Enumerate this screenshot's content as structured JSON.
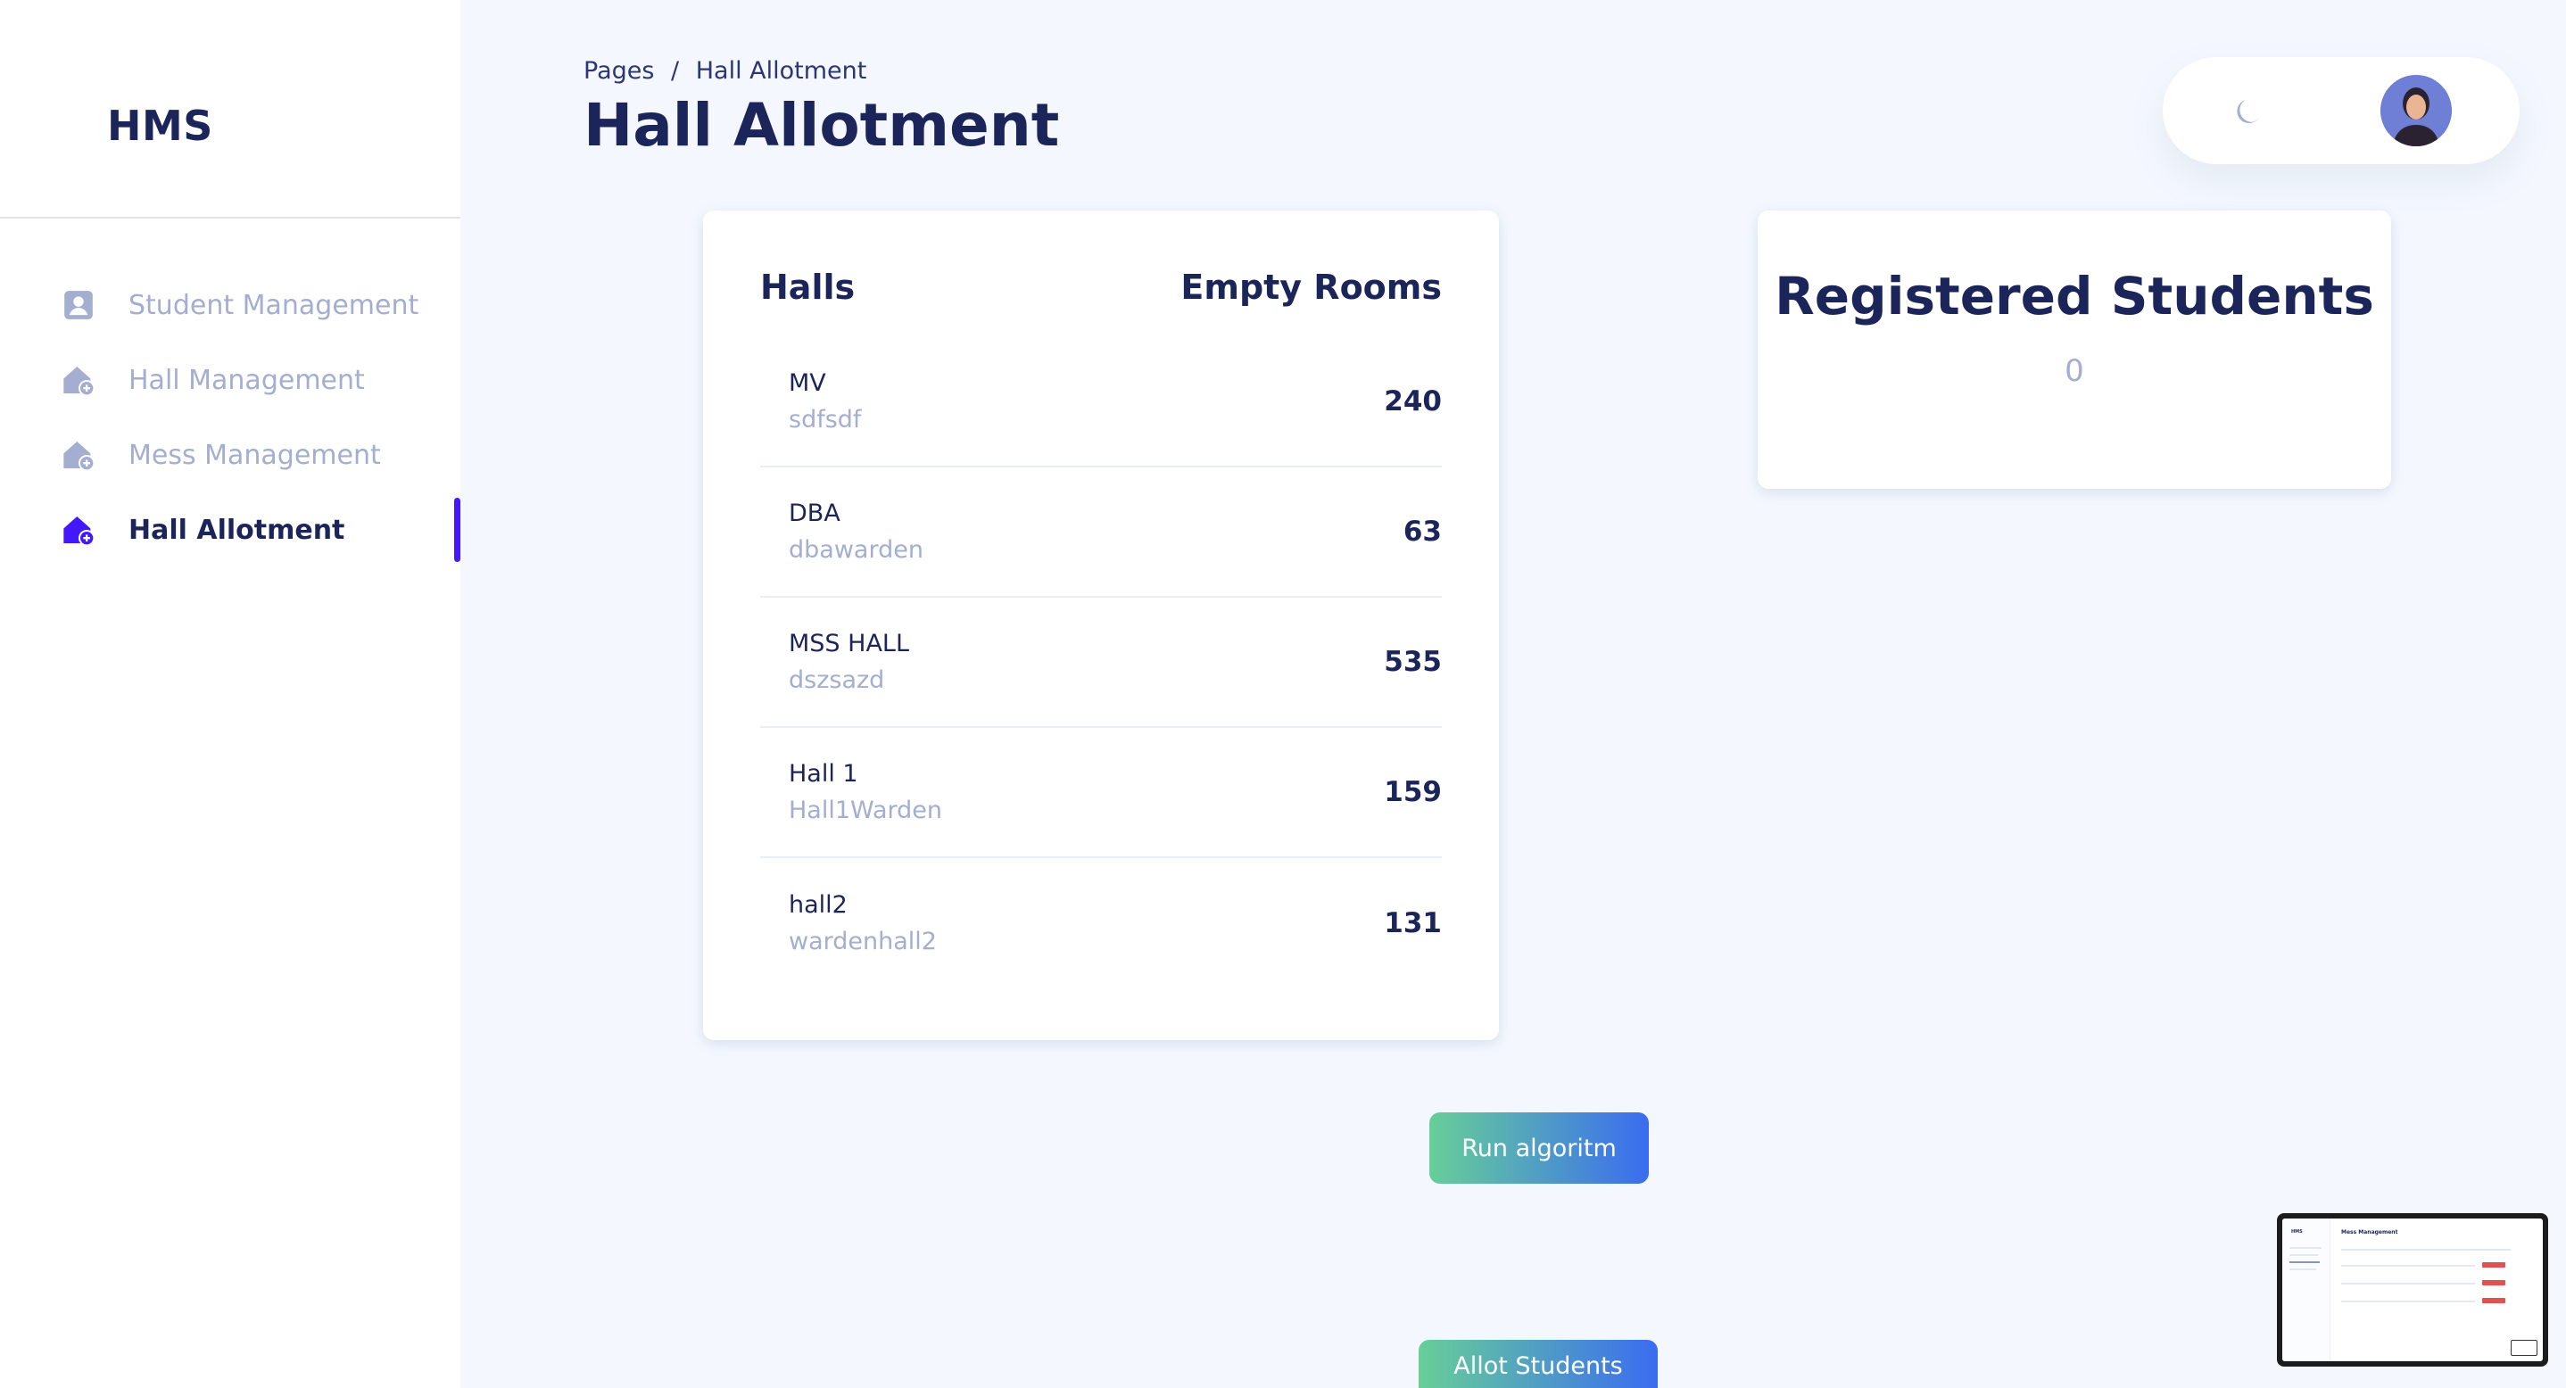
{
  "sidebar": {
    "brand": "HMS",
    "items": [
      {
        "label": "Student Management",
        "icon": "user-square-icon",
        "active": false
      },
      {
        "label": "Hall Management",
        "icon": "home-plus-icon",
        "active": false
      },
      {
        "label": "Mess Management",
        "icon": "home-plus-icon",
        "active": false
      },
      {
        "label": "Hall Allotment",
        "icon": "home-plus-icon",
        "active": true
      }
    ]
  },
  "header": {
    "breadcrumb_root": "Pages",
    "breadcrumb_separator": "/",
    "breadcrumb_current": "Hall Allotment",
    "title": "Hall Allotment",
    "theme_icon": "moon-icon"
  },
  "halls_card": {
    "col_halls": "Halls",
    "col_empty_rooms": "Empty Rooms",
    "rows": [
      {
        "name": "MV",
        "warden": "sdfsdf",
        "empty_rooms": "240"
      },
      {
        "name": "DBA",
        "warden": "dbawarden",
        "empty_rooms": "63"
      },
      {
        "name": "MSS HALL",
        "warden": "dszsazd",
        "empty_rooms": "535"
      },
      {
        "name": "Hall 1",
        "warden": "Hall1Warden",
        "empty_rooms": "159"
      },
      {
        "name": "hall2",
        "warden": "wardenhall2",
        "empty_rooms": "131"
      }
    ]
  },
  "students_card": {
    "title": "Registered Students",
    "count": "0"
  },
  "buttons": {
    "run": "Run algoritm",
    "allot": "Allot Students"
  },
  "preview": {
    "title": "Mess Management",
    "brand": "HMS"
  },
  "colors": {
    "accent": "#4318ff",
    "text_primary": "#1b2559",
    "text_muted": "#a3aed0",
    "background": "#f4f7fe",
    "button_gradient_start": "#67cf98",
    "button_gradient_end": "#3a6cf0"
  }
}
